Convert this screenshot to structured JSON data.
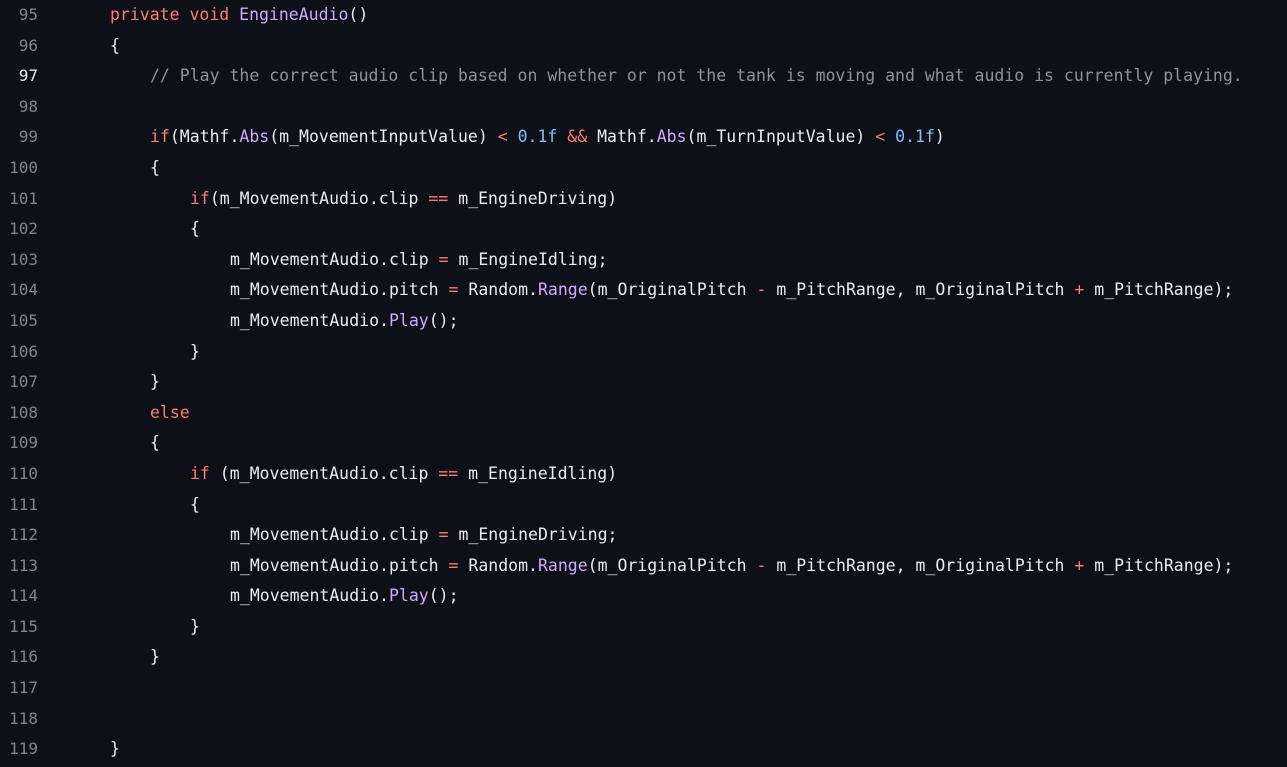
{
  "editor": {
    "active_line": 97,
    "colors": {
      "background": "#0d1117",
      "keyword": "#ff7b72",
      "function": "#d2a8ff",
      "number": "#79c0ff",
      "comment": "#8b949e",
      "text": "#e6edf3",
      "line_number": "#7d8590"
    },
    "lines": [
      {
        "num": "95",
        "indent": 0,
        "tokens": [
          [
            "kw",
            "private void "
          ],
          [
            "fn",
            "EngineAudio"
          ],
          [
            "plain",
            "()"
          ]
        ]
      },
      {
        "num": "96",
        "indent": 0,
        "tokens": [
          [
            "plain",
            "{"
          ]
        ]
      },
      {
        "num": "97",
        "indent": 1,
        "tokens": [
          [
            "cm",
            "// Play the correct audio clip based on whether or not the tank is moving and what audio is currently playing."
          ]
        ]
      },
      {
        "num": "98",
        "indent": 0,
        "tokens": []
      },
      {
        "num": "99",
        "indent": 1,
        "tokens": [
          [
            "kw",
            "if"
          ],
          [
            "plain",
            "(Mathf."
          ],
          [
            "fn",
            "Abs"
          ],
          [
            "plain",
            "(m_MovementInputValue) "
          ],
          [
            "op",
            "<"
          ],
          [
            "plain",
            " "
          ],
          [
            "num",
            "0.1f"
          ],
          [
            "plain",
            " "
          ],
          [
            "op",
            "&&"
          ],
          [
            "plain",
            " Mathf."
          ],
          [
            "fn",
            "Abs"
          ],
          [
            "plain",
            "(m_TurnInputValue) "
          ],
          [
            "op",
            "<"
          ],
          [
            "plain",
            " "
          ],
          [
            "num",
            "0.1f"
          ],
          [
            "plain",
            ")"
          ]
        ]
      },
      {
        "num": "100",
        "indent": 1,
        "tokens": [
          [
            "plain",
            "{"
          ]
        ]
      },
      {
        "num": "101",
        "indent": 2,
        "tokens": [
          [
            "kw",
            "if"
          ],
          [
            "plain",
            "(m_MovementAudio.clip "
          ],
          [
            "op",
            "=="
          ],
          [
            "plain",
            " m_EngineDriving)"
          ]
        ]
      },
      {
        "num": "102",
        "indent": 2,
        "tokens": [
          [
            "plain",
            "{"
          ]
        ]
      },
      {
        "num": "103",
        "indent": 3,
        "tokens": [
          [
            "plain",
            "m_MovementAudio.clip "
          ],
          [
            "op",
            "="
          ],
          [
            "plain",
            " m_EngineIdling;"
          ]
        ]
      },
      {
        "num": "104",
        "indent": 3,
        "tokens": [
          [
            "plain",
            "m_MovementAudio.pitch "
          ],
          [
            "op",
            "="
          ],
          [
            "plain",
            " Random."
          ],
          [
            "fn",
            "Range"
          ],
          [
            "plain",
            "(m_OriginalPitch "
          ],
          [
            "op",
            "-"
          ],
          [
            "plain",
            " m_PitchRange, m_OriginalPitch "
          ],
          [
            "op",
            "+"
          ],
          [
            "plain",
            " m_PitchRange);"
          ]
        ]
      },
      {
        "num": "105",
        "indent": 3,
        "tokens": [
          [
            "plain",
            "m_MovementAudio."
          ],
          [
            "fn",
            "Play"
          ],
          [
            "plain",
            "();"
          ]
        ]
      },
      {
        "num": "106",
        "indent": 2,
        "tokens": [
          [
            "plain",
            "}"
          ]
        ]
      },
      {
        "num": "107",
        "indent": 1,
        "tokens": [
          [
            "plain",
            "}"
          ]
        ]
      },
      {
        "num": "108",
        "indent": 1,
        "tokens": [
          [
            "kw",
            "else"
          ]
        ]
      },
      {
        "num": "109",
        "indent": 1,
        "tokens": [
          [
            "plain",
            "{"
          ]
        ]
      },
      {
        "num": "110",
        "indent": 2,
        "tokens": [
          [
            "kw",
            "if"
          ],
          [
            "plain",
            " (m_MovementAudio.clip "
          ],
          [
            "op",
            "=="
          ],
          [
            "plain",
            " m_EngineIdling)"
          ]
        ]
      },
      {
        "num": "111",
        "indent": 2,
        "tokens": [
          [
            "plain",
            "{"
          ]
        ]
      },
      {
        "num": "112",
        "indent": 3,
        "tokens": [
          [
            "plain",
            "m_MovementAudio.clip "
          ],
          [
            "op",
            "="
          ],
          [
            "plain",
            " m_EngineDriving;"
          ]
        ]
      },
      {
        "num": "113",
        "indent": 3,
        "tokens": [
          [
            "plain",
            "m_MovementAudio.pitch "
          ],
          [
            "op",
            "="
          ],
          [
            "plain",
            " Random."
          ],
          [
            "fn",
            "Range"
          ],
          [
            "plain",
            "(m_OriginalPitch "
          ],
          [
            "op",
            "-"
          ],
          [
            "plain",
            " m_PitchRange, m_OriginalPitch "
          ],
          [
            "op",
            "+"
          ],
          [
            "plain",
            " m_PitchRange);"
          ]
        ]
      },
      {
        "num": "114",
        "indent": 3,
        "tokens": [
          [
            "plain",
            "m_MovementAudio."
          ],
          [
            "fn",
            "Play"
          ],
          [
            "plain",
            "();"
          ]
        ]
      },
      {
        "num": "115",
        "indent": 2,
        "tokens": [
          [
            "plain",
            "}"
          ]
        ]
      },
      {
        "num": "116",
        "indent": 1,
        "tokens": [
          [
            "plain",
            "}"
          ]
        ]
      },
      {
        "num": "117",
        "indent": 0,
        "tokens": []
      },
      {
        "num": "118",
        "indent": 0,
        "tokens": []
      },
      {
        "num": "119",
        "indent": 0,
        "tokens": [
          [
            "plain",
            "}"
          ]
        ]
      }
    ]
  }
}
